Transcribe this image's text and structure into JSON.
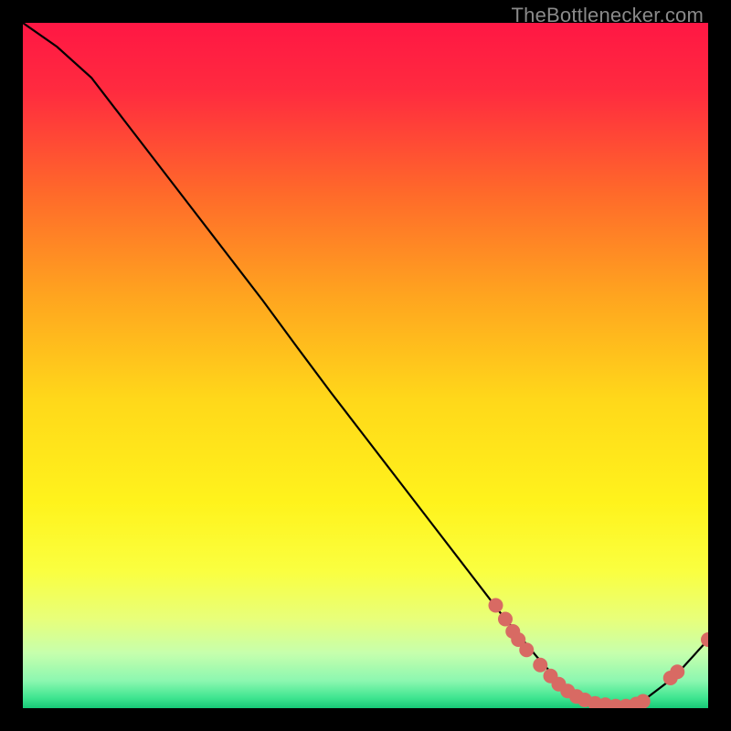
{
  "watermark": "TheBottlenecker.com",
  "chart_data": {
    "type": "line",
    "x": [
      0.0,
      0.05,
      0.1,
      0.15,
      0.2,
      0.25,
      0.3,
      0.35,
      0.4,
      0.45,
      0.5,
      0.55,
      0.6,
      0.65,
      0.7,
      0.725,
      0.75,
      0.775,
      0.8,
      0.825,
      0.85,
      0.875,
      0.9,
      0.95,
      1.0
    ],
    "values": [
      1.0,
      0.965,
      0.92,
      0.855,
      0.79,
      0.725,
      0.66,
      0.595,
      0.527,
      0.46,
      0.395,
      0.33,
      0.265,
      0.2,
      0.135,
      0.105,
      0.075,
      0.047,
      0.025,
      0.012,
      0.005,
      0.003,
      0.007,
      0.045,
      0.1
    ],
    "marker_points": [
      {
        "x": 0.69,
        "y": 0.15
      },
      {
        "x": 0.704,
        "y": 0.13
      },
      {
        "x": 0.715,
        "y": 0.112
      },
      {
        "x": 0.723,
        "y": 0.1
      },
      {
        "x": 0.735,
        "y": 0.085
      },
      {
        "x": 0.755,
        "y": 0.063
      },
      {
        "x": 0.77,
        "y": 0.047
      },
      {
        "x": 0.782,
        "y": 0.035
      },
      {
        "x": 0.795,
        "y": 0.025
      },
      {
        "x": 0.808,
        "y": 0.017
      },
      {
        "x": 0.82,
        "y": 0.012
      },
      {
        "x": 0.835,
        "y": 0.007
      },
      {
        "x": 0.85,
        "y": 0.005
      },
      {
        "x": 0.865,
        "y": 0.003
      },
      {
        "x": 0.88,
        "y": 0.003
      },
      {
        "x": 0.895,
        "y": 0.006
      },
      {
        "x": 0.905,
        "y": 0.01
      },
      {
        "x": 0.945,
        "y": 0.044
      },
      {
        "x": 0.955,
        "y": 0.053
      },
      {
        "x": 1.0,
        "y": 0.1
      }
    ],
    "title": "",
    "xlabel": "",
    "ylabel": "",
    "xlim": [
      0,
      1
    ],
    "ylim": [
      0,
      1
    ],
    "gradient_stops": [
      {
        "offset": 0.0,
        "color": "#ff1744"
      },
      {
        "offset": 0.1,
        "color": "#ff2b3f"
      },
      {
        "offset": 0.25,
        "color": "#ff6a2a"
      },
      {
        "offset": 0.4,
        "color": "#ffa51f"
      },
      {
        "offset": 0.55,
        "color": "#ffd81a"
      },
      {
        "offset": 0.7,
        "color": "#fff31c"
      },
      {
        "offset": 0.8,
        "color": "#faff40"
      },
      {
        "offset": 0.87,
        "color": "#e8ff7a"
      },
      {
        "offset": 0.92,
        "color": "#c6ffad"
      },
      {
        "offset": 0.96,
        "color": "#8cf7b0"
      },
      {
        "offset": 0.985,
        "color": "#3fe590"
      },
      {
        "offset": 1.0,
        "color": "#17c877"
      }
    ],
    "line_color": "#000000",
    "marker_color": "#d86a63",
    "marker_size": 8
  }
}
